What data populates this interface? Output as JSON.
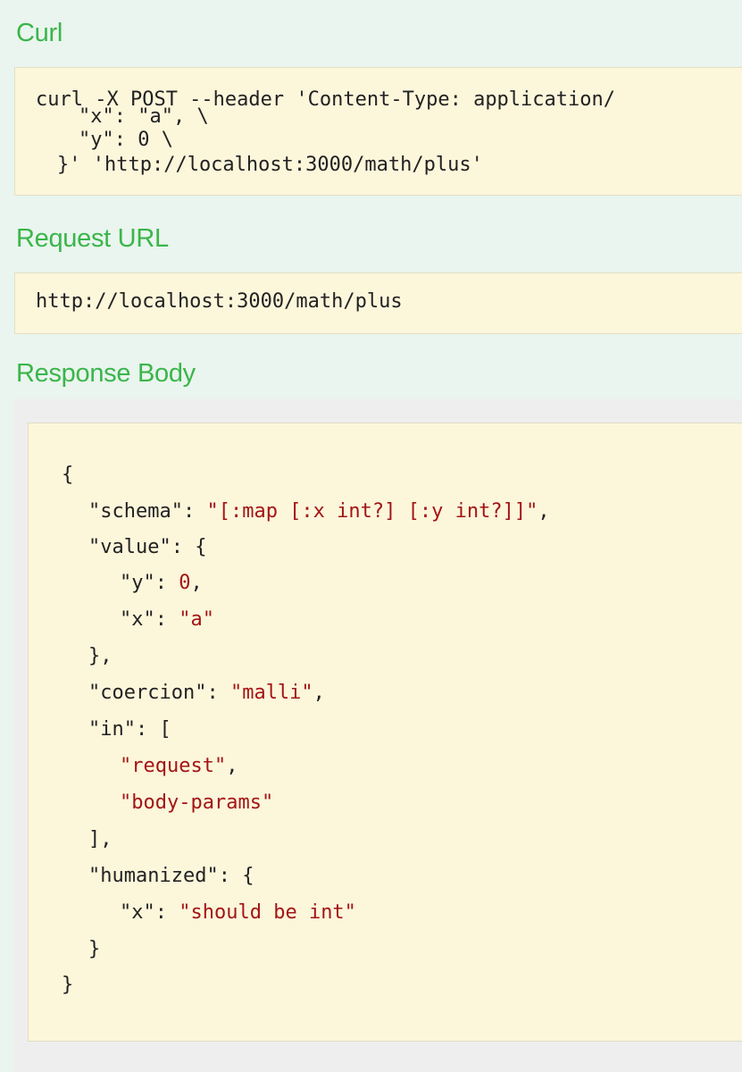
{
  "curl": {
    "heading": "Curl",
    "lines": [
      "curl -X POST --header 'Content-Type: application/",
      "\"x\": \"a\", \\",
      "\"y\": 0 \\",
      "}' 'http://localhost:3000/math/plus'"
    ]
  },
  "request_url": {
    "heading": "Request URL",
    "value": "http://localhost:3000/math/plus"
  },
  "response_body": {
    "heading": "Response Body",
    "open_brace": "{",
    "schema_key": "\"schema\"",
    "schema_value": "\"[:map [:x int?] [:y int?]]\"",
    "value_key": "\"value\"",
    "value_open": "{",
    "y_key": "\"y\"",
    "y_value": "0",
    "x_key": "\"x\"",
    "x_value": "\"a\"",
    "value_close": "},",
    "coercion_key": "\"coercion\"",
    "coercion_value": "\"malli\"",
    "in_key": "\"in\"",
    "in_open": "[",
    "in_items": [
      "\"request\"",
      "\"body-params\""
    ],
    "in_close": "],",
    "humanized_key": "\"humanized\"",
    "humanized_open": "{",
    "humanized_x_key": "\"x\"",
    "humanized_x_value": "\"should be int\"",
    "humanized_close": "}",
    "close_brace": "}"
  },
  "colors": {
    "heading": "#3bb54a",
    "background": "#e9f5ee",
    "code_background": "#fcf6db",
    "string": "#a31515"
  }
}
